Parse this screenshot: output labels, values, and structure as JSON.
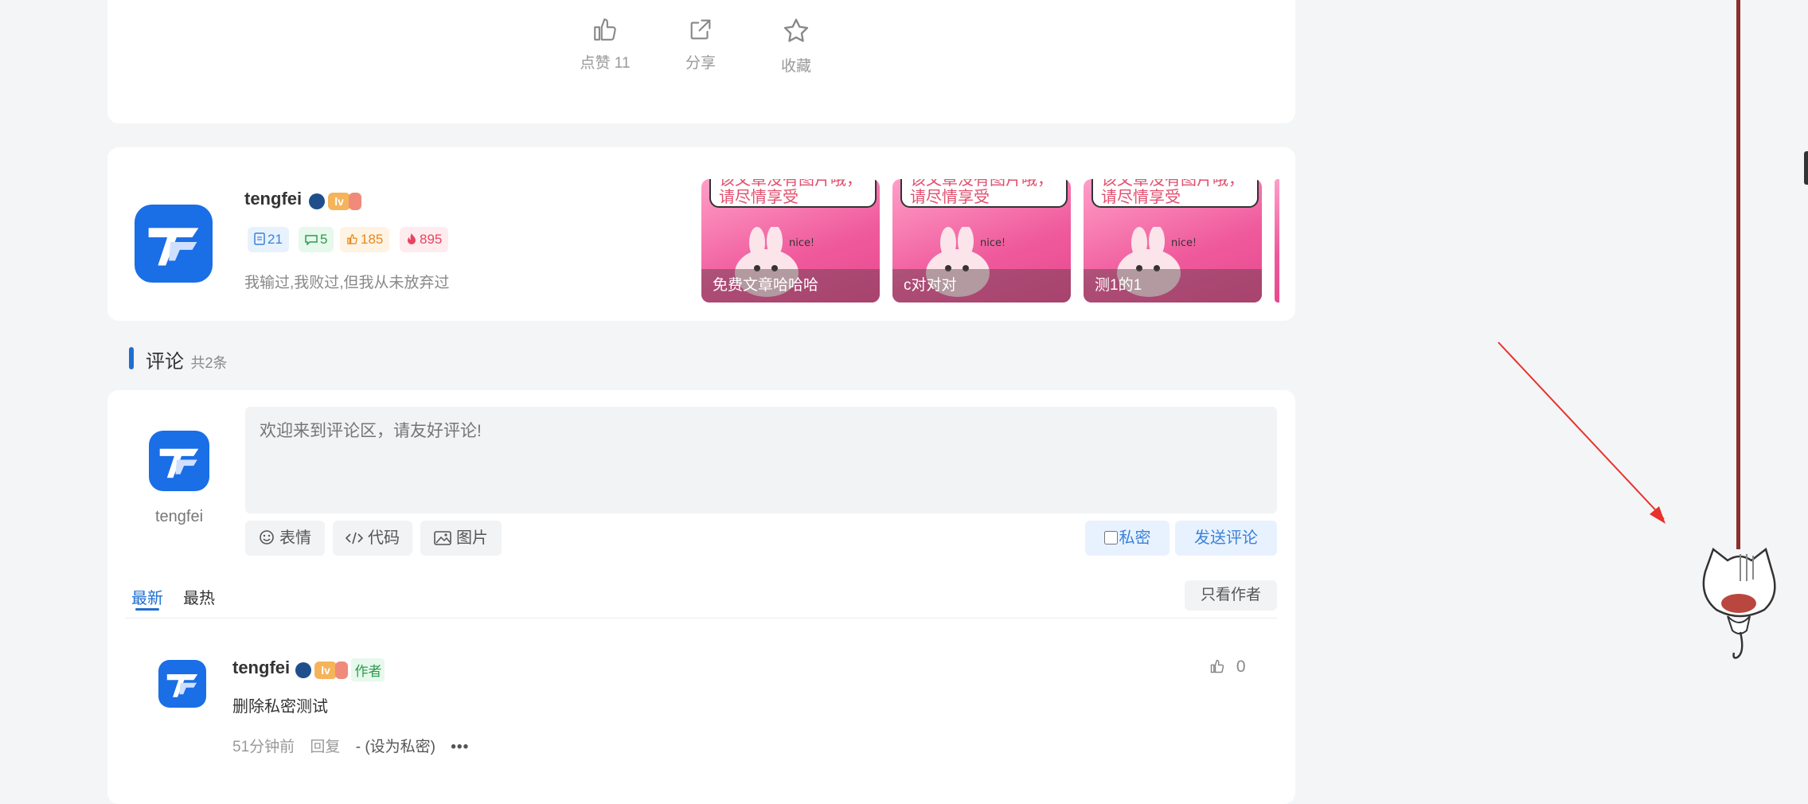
{
  "actions": {
    "like_label": "点赞",
    "like_count": "11",
    "share_label": "分享",
    "favorite_label": "收藏"
  },
  "author": {
    "name": "tengfei",
    "level_badge": "",
    "stats": {
      "articles": "21",
      "comments": "5",
      "likes": "185",
      "hot": "895"
    },
    "bio": "我输过,我败过,但我从未放弃过"
  },
  "thumbnails": [
    {
      "title": "免费文章哈哈哈",
      "bubble": "该文章没有图片哦，\n请尽情享受"
    },
    {
      "title": "c对对对",
      "bubble": "该文章没有图片哦，\n请尽情享受"
    },
    {
      "title": "测1的1",
      "bubble": "该文章没有图片哦，\n请尽情享受"
    }
  ],
  "comments_section": {
    "title": "评论",
    "count_text": "共2条"
  },
  "composer": {
    "user_name": "tengfei",
    "placeholder": "欢迎来到评论区，请友好评论!",
    "emoji_label": "表情",
    "code_label": "代码",
    "image_label": "图片",
    "private_label": "私密",
    "submit_label": "发送评论"
  },
  "sort_tabs": {
    "latest": "最新",
    "hottest": "最热",
    "author_only": "只看作者"
  },
  "comment": {
    "user_name": "tengfei",
    "author_tag": "作者",
    "content": "删除私密测试",
    "time": "51分钟前",
    "reply_label": "回复",
    "private_action": "- (设为私密)",
    "like_count": "0"
  },
  "colors": {
    "accent": "#1f6fd1",
    "background": "#f4f5f7",
    "arrow": "#e8322b"
  }
}
